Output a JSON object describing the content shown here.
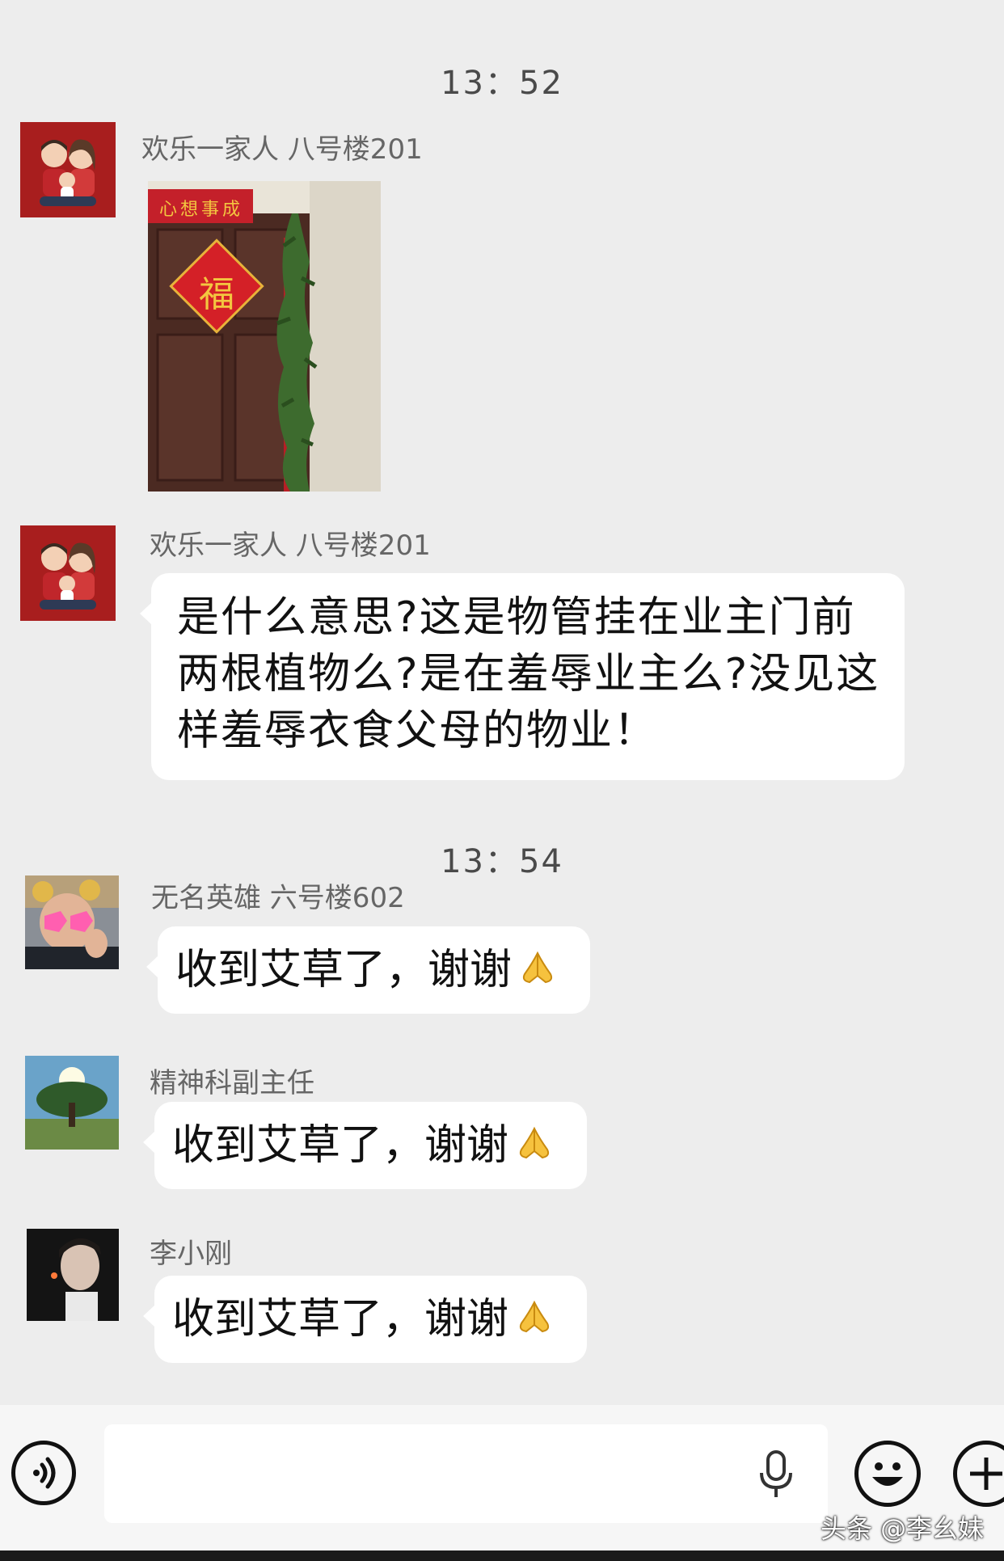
{
  "times": [
    "13：52",
    "13：54"
  ],
  "messages": [
    {
      "sender": "欢乐一家人 八号楼201",
      "type": "image"
    },
    {
      "sender": "欢乐一家人 八号楼201",
      "lines": [
        "是什么意思?这是物管挂在业主门前",
        "两根植物么?是在羞辱业主么?没见这",
        "样羞辱衣食父母的物业！"
      ]
    },
    {
      "sender": "无名英雄 六号楼602",
      "text": "收到艾草了，谢谢"
    },
    {
      "sender": "精神科副主任",
      "text": "收到艾草了，谢谢"
    },
    {
      "sender": "李小刚",
      "text": "收到艾草了，谢谢"
    }
  ],
  "photo": {
    "banner": "心想事成",
    "fu": "福"
  },
  "input": {
    "placeholder": ""
  },
  "icons": {
    "voice": "voice-icon",
    "mic": "microphone-icon",
    "emoji": "emoji-icon",
    "plus": "plus-icon",
    "pray": "pray-icon"
  },
  "watermark": "头条 @李幺妹",
  "colors": {
    "background": "#ededed",
    "bubble": "#ffffff",
    "name": "#666666"
  }
}
